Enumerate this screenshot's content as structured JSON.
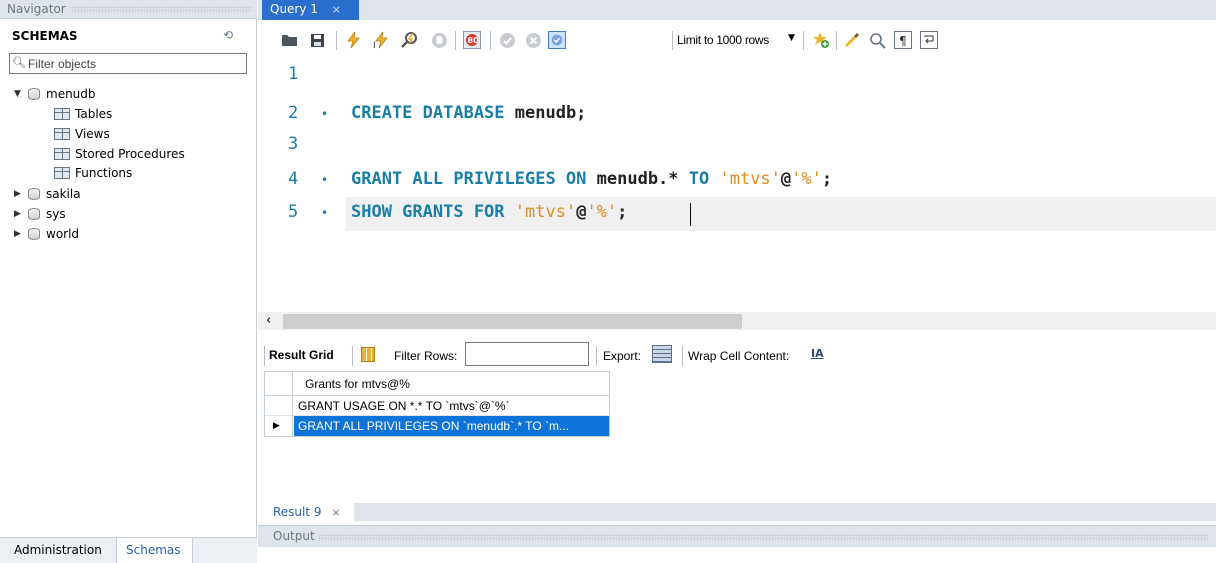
{
  "navigator": {
    "title": "Navigator",
    "schemas_label": "SCHEMAS",
    "filter_placeholder": "Filter objects",
    "tree": [
      {
        "label": "menudb",
        "expanded": true,
        "children": [
          "Tables",
          "Views",
          "Stored Procedures",
          "Functions"
        ]
      },
      {
        "label": "sakila",
        "expanded": false
      },
      {
        "label": "sys",
        "expanded": false
      },
      {
        "label": "world",
        "expanded": false
      }
    ],
    "bottom_tabs": {
      "administration": "Administration",
      "schemas": "Schemas"
    }
  },
  "query_tab": {
    "label": "Query 1",
    "close": "×"
  },
  "toolbar": {
    "limit_label": "Limit to 1000 rows",
    "icons": [
      "open-folder-icon",
      "save-icon",
      "execute-icon",
      "execute-current-icon",
      "explain-icon",
      "stop-icon",
      "toggle-error-icon",
      "commit-icon",
      "rollback-icon",
      "autocommit-icon",
      "limit-dropdown",
      "bookmark-icon",
      "beautify-icon",
      "find-icon",
      "invisible-chars-icon",
      "wrap-icon"
    ]
  },
  "editor": {
    "lines": [
      {
        "no": "1",
        "bullet": "",
        "keywords": [],
        "text": ""
      },
      {
        "no": "2",
        "bullet": "•",
        "kw1": "CREATE DATABASE",
        "rest": " menudb;"
      },
      {
        "no": "3",
        "bullet": ""
      },
      {
        "no": "4",
        "bullet": "•",
        "kw1": "GRANT ALL PRIVILEGES ON",
        "mid": " menudb.* ",
        "kw2": "TO",
        "str": " 'mtvs'",
        "at": "@",
        "str2": "'%'",
        "end": ";"
      },
      {
        "no": "5",
        "bullet": "•",
        "kw1": "SHOW GRANTS FOR",
        "str": " 'mtvs'",
        "at": "@",
        "str2": "'%'",
        "end": ";"
      }
    ]
  },
  "result_toolbar": {
    "result_grid": "Result Grid",
    "filter_rows": "Filter Rows:",
    "export": "Export:",
    "wrap_cell": "Wrap Cell Content:",
    "wrap_icon": "IA"
  },
  "grid": {
    "column": "Grants for mtvs@%",
    "rows": [
      "GRANT USAGE ON *.* TO `mtvs`@`%`",
      "GRANT ALL PRIVILEGES ON `menudb`.* TO `m..."
    ],
    "current_row_marker": "▶"
  },
  "result_tab": {
    "label": "Result 9",
    "close": "×"
  },
  "output": {
    "label": "Output"
  }
}
